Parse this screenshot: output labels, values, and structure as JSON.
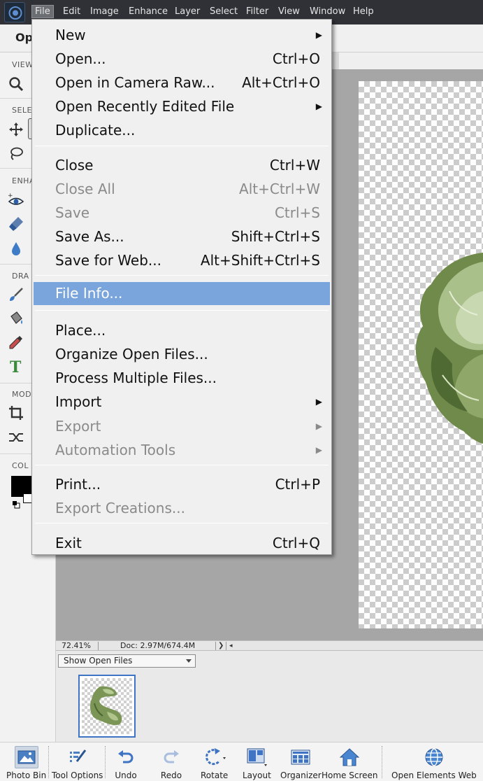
{
  "menubar": {
    "items": [
      "File",
      "Edit",
      "Image",
      "Enhance",
      "Layer",
      "Select",
      "Filter",
      "View",
      "Window",
      "Help"
    ]
  },
  "options_bar": {
    "label": "Op"
  },
  "toolbox": {
    "sections": [
      "VIEW",
      "SELE",
      "ENHA",
      "DRA",
      "MOD",
      "COL"
    ]
  },
  "file_menu": {
    "items": [
      {
        "label": "New",
        "shortcut": "",
        "submenu": true,
        "enabled": true
      },
      {
        "label": "Open...",
        "shortcut": "Ctrl+O",
        "submenu": false,
        "enabled": true
      },
      {
        "label": "Open in Camera Raw...",
        "shortcut": "Alt+Ctrl+O",
        "submenu": false,
        "enabled": true
      },
      {
        "label": "Open Recently Edited File",
        "shortcut": "",
        "submenu": true,
        "enabled": true
      },
      {
        "label": "Duplicate...",
        "shortcut": "",
        "submenu": false,
        "enabled": true
      },
      {
        "label": "Close",
        "shortcut": "Ctrl+W",
        "submenu": false,
        "enabled": true
      },
      {
        "label": "Close All",
        "shortcut": "Alt+Ctrl+W",
        "submenu": false,
        "enabled": false
      },
      {
        "label": "Save",
        "shortcut": "Ctrl+S",
        "submenu": false,
        "enabled": false
      },
      {
        "label": "Save As...",
        "shortcut": "Shift+Ctrl+S",
        "submenu": false,
        "enabled": true
      },
      {
        "label": "Save for Web...",
        "shortcut": "Alt+Shift+Ctrl+S",
        "submenu": false,
        "enabled": true
      },
      {
        "label": "File Info...",
        "shortcut": "",
        "submenu": false,
        "enabled": true,
        "highlighted": true
      },
      {
        "label": "Place...",
        "shortcut": "",
        "submenu": false,
        "enabled": true
      },
      {
        "label": "Organize Open Files...",
        "shortcut": "",
        "submenu": false,
        "enabled": true
      },
      {
        "label": "Process Multiple Files...",
        "shortcut": "",
        "submenu": false,
        "enabled": true
      },
      {
        "label": "Import",
        "shortcut": "",
        "submenu": true,
        "enabled": true
      },
      {
        "label": "Export",
        "shortcut": "",
        "submenu": true,
        "enabled": false
      },
      {
        "label": "Automation Tools",
        "shortcut": "",
        "submenu": true,
        "enabled": false
      },
      {
        "label": "Print...",
        "shortcut": "Ctrl+P",
        "submenu": false,
        "enabled": true
      },
      {
        "label": "Export Creations...",
        "shortcut": "",
        "submenu": false,
        "enabled": false
      },
      {
        "label": "Exit",
        "shortcut": "Ctrl+Q",
        "submenu": false,
        "enabled": true
      }
    ]
  },
  "status": {
    "zoom": "72.41%",
    "doc_size": "Doc: 2.97M/674.4M"
  },
  "photo_bin": {
    "selector_value": "Show Open Files"
  },
  "taskbar": {
    "buttons": [
      "Photo Bin",
      "Tool Options",
      "Undo",
      "Redo",
      "Rotate",
      "Layout",
      "Organizer",
      "Home Screen",
      "Open Elements Web"
    ]
  },
  "colors": {
    "menu_highlight": "#7aa5dc",
    "menubar_bg": "#2f3136",
    "foreground_swatch": "#000000",
    "background_swatch": "#ffffff"
  }
}
